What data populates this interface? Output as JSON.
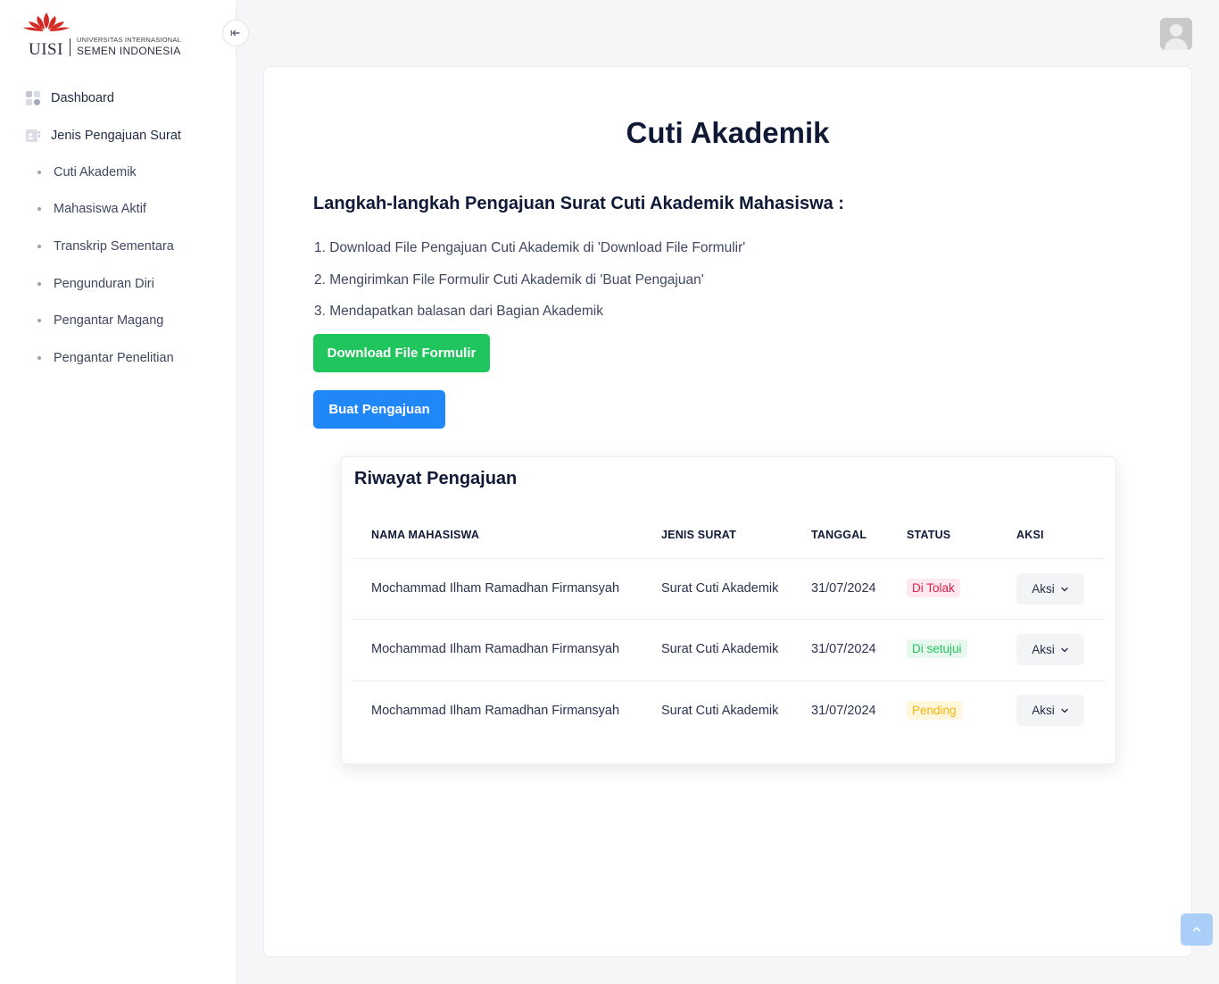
{
  "logo": {
    "brand_small": "UNIVERSITAS INTERNASIONAL",
    "brand_big": "SEMEN INDONESIA",
    "acronym": "UISI",
    "accent": "#d42a26"
  },
  "sidebar": {
    "items": [
      {
        "label": "Dashboard",
        "icon": "grid-icon"
      },
      {
        "label": "Jenis Pengajuan Surat",
        "icon": "document-icon"
      }
    ],
    "subitems": [
      {
        "label": "Cuti Akademik"
      },
      {
        "label": "Mahasiswa Aktif"
      },
      {
        "label": "Transkrip Sementara"
      },
      {
        "label": "Pengunduran Diri"
      },
      {
        "label": "Pengantar Magang"
      },
      {
        "label": "Pengantar Penelitian"
      }
    ]
  },
  "main": {
    "title": "Cuti Akademik",
    "steps_title": "Langkah-langkah Pengajuan Surat Cuti Akademik Mahasiswa :",
    "steps": [
      "1. Download File Pengajuan Cuti Akademik di 'Download File Formulir'",
      "2. Mengirimkan File Formulir Cuti Akademik di 'Buat Pengajuan'",
      "3. Mendapatkan balasan dari Bagian Akademik"
    ],
    "download_label": "Download File Formulir",
    "create_label": "Buat Pengajuan",
    "download_color": "#21c55d",
    "create_color": "#1f87f8"
  },
  "history": {
    "title": "Riwayat Pengajuan",
    "columns": [
      "NAMA MAHASISWA",
      "JENIS SURAT",
      "TANGGAL",
      "STATUS",
      "AKSI"
    ],
    "rows": [
      {
        "name": "Mochammad Ilham Ramadhan Firmansyah",
        "type": "Surat Cuti Akademik",
        "date": "31/07/2024",
        "status": "Di Tolak",
        "action": "Aksi"
      },
      {
        "name": "Mochammad Ilham Ramadhan Firmansyah",
        "type": "Surat Cuti Akademik",
        "date": "31/07/2024",
        "status": "Di setujui",
        "action": "Aksi"
      },
      {
        "name": "Mochammad Ilham Ramadhan Firmansyah",
        "type": "Surat Cuti Akademik",
        "date": "31/07/2024",
        "status": "Pending",
        "action": "Aksi"
      }
    ],
    "status_colors": {
      "rejected": "#e11d48",
      "approved": "#22c55e",
      "pending": "#f5b30b"
    }
  }
}
